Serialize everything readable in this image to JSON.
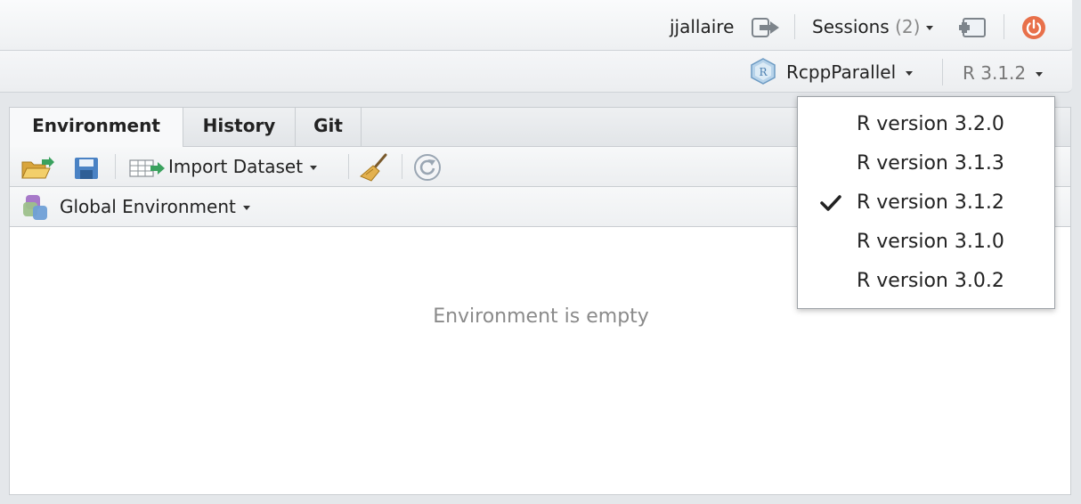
{
  "topbar": {
    "username": "jjallaire",
    "sessions_label": "Sessions",
    "sessions_count": "(2)"
  },
  "projectbar": {
    "project_name": "RcppParallel",
    "r_version": "R 3.1.2"
  },
  "pane": {
    "tabs": [
      {
        "label": "Environment",
        "active": true
      },
      {
        "label": "History",
        "active": false
      },
      {
        "label": "Git",
        "active": false
      }
    ],
    "toolbar": {
      "import_label": "Import Dataset"
    },
    "environment_selector": "Global Environment",
    "empty_message": "Environment is empty"
  },
  "version_menu": {
    "items": [
      {
        "label": "R version 3.2.0",
        "checked": false
      },
      {
        "label": "R version 3.1.3",
        "checked": false
      },
      {
        "label": "R version 3.1.2",
        "checked": true
      },
      {
        "label": "R version 3.1.0",
        "checked": false
      },
      {
        "label": "R version 3.0.2",
        "checked": false
      }
    ]
  },
  "colors": {
    "power_icon": "#e8704a",
    "empty_text": "#8a8a8a",
    "import_arrow": "#3aa15e"
  }
}
